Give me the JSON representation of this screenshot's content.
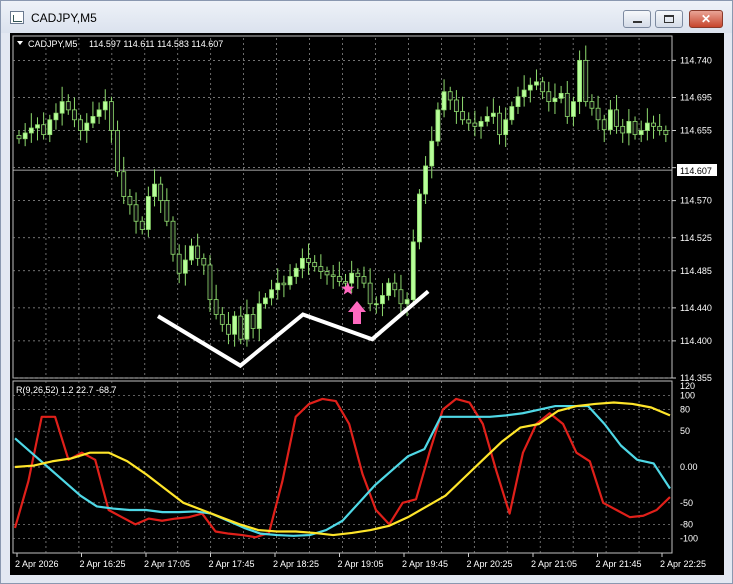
{
  "window": {
    "title": "CADJPY,M5",
    "close_glyph": "✕"
  },
  "chart_header": {
    "symbol": "CADJPY,M5",
    "ohlc": "114.597 114.611 114.583 114.607"
  },
  "indicator_label": "R(9,26,52) 1.2 22.7 -68.7",
  "current_price": "114.607",
  "colors": {
    "background": "#000000",
    "bull_candle": "#b8ff9a",
    "bear_candle": "#111111",
    "wick": "#8fdc6f",
    "grid": "#9a9a9a",
    "red_line": "#e0201a",
    "cyan_line": "#4fd8e6",
    "yellow_line": "#ffe52a",
    "star_arrow": "#ff69c0",
    "annotation_line": "#ffffff"
  },
  "chart_data": [
    {
      "type": "candlestick",
      "symbol": "CADJPY",
      "timeframe": "M5",
      "y_ticks": [
        "114.740",
        "114.695",
        "114.655",
        "114.610",
        "114.570",
        "114.525",
        "114.485",
        "114.440",
        "114.400",
        "114.355"
      ],
      "ylim": [
        114.355,
        114.755
      ],
      "x_labels": [
        "2 Apr 2026",
        "2 Apr 16:25",
        "2 Apr 17:05",
        "2 Apr 17:45",
        "2 Apr 18:25",
        "2 Apr 19:05",
        "2 Apr 19:45",
        "2 Apr 20:25",
        "2 Apr 21:05",
        "2 Apr 21:45",
        "2 Apr 22:25"
      ],
      "close_path": [
        114.645,
        114.652,
        114.658,
        114.662,
        114.65,
        114.668,
        114.676,
        114.69,
        114.68,
        114.668,
        114.655,
        114.664,
        114.672,
        114.68,
        114.69,
        114.655,
        114.605,
        114.575,
        114.565,
        114.545,
        114.535,
        114.575,
        114.59,
        114.57,
        114.545,
        114.505,
        114.482,
        114.498,
        114.515,
        114.5,
        114.492,
        114.45,
        114.432,
        114.42,
        114.408,
        114.43,
        114.402,
        114.432,
        114.415,
        114.445,
        114.452,
        114.462,
        114.47,
        114.468,
        114.478,
        114.488,
        114.5,
        114.495,
        114.49,
        114.484,
        114.48,
        114.478,
        114.472,
        114.47,
        114.482,
        114.478,
        114.47,
        114.445,
        114.445,
        114.455,
        114.47,
        114.462,
        114.445,
        114.45,
        114.52,
        114.578,
        114.612,
        114.642,
        114.68,
        114.702,
        114.692,
        114.678,
        114.668,
        114.664,
        114.66,
        114.666,
        114.672,
        114.676,
        114.65,
        114.668,
        114.684,
        114.696,
        114.704,
        114.71,
        114.714,
        114.702,
        114.69,
        114.694,
        114.7,
        114.672,
        114.69,
        114.74,
        114.69,
        114.682,
        114.668,
        114.656,
        114.68,
        114.66,
        114.652,
        114.666,
        114.65,
        114.655,
        114.664,
        114.66,
        114.655,
        114.65
      ],
      "annotations": [
        {
          "kind": "polyline",
          "points_price_units": "double-bottom W pattern (white)"
        },
        {
          "kind": "star",
          "price": 114.463
        },
        {
          "kind": "up-arrow",
          "price": 114.435
        }
      ]
    },
    {
      "type": "line",
      "title": "R(9,26,52)",
      "values_shown": [
        1.2,
        22.7,
        -68.7
      ],
      "y_ticks": [
        "120",
        "100",
        "80",
        "50",
        "0.00",
        "-50",
        "-80",
        "-100"
      ],
      "ylim": [
        -120,
        120
      ],
      "series": [
        {
          "color": "#e0201a",
          "values": [
            -85,
            -20,
            70,
            70,
            10,
            20,
            10,
            -60,
            -70,
            -80,
            -72,
            -75,
            -72,
            -70,
            -65,
            -90,
            -93,
            -95,
            -98,
            -92,
            -20,
            70,
            88,
            95,
            92,
            60,
            -10,
            -60,
            -80,
            -50,
            -45,
            20,
            80,
            95,
            90,
            60,
            -5,
            -65,
            20,
            60,
            75,
            60,
            20,
            8,
            -50,
            -60,
            -70,
            -68,
            -60,
            -42
          ]
        },
        {
          "color": "#4fd8e6",
          "values": [
            40,
            20,
            0,
            -20,
            -40,
            -55,
            -58,
            -60,
            -60,
            -63,
            -63,
            -62,
            -65,
            -75,
            -85,
            -93,
            -95,
            -96,
            -95,
            -88,
            -75,
            -50,
            -25,
            -5,
            15,
            25,
            70,
            70,
            70,
            70,
            72,
            75,
            80,
            85,
            85,
            85,
            60,
            30,
            10,
            5,
            -30
          ]
        },
        {
          "color": "#ffe52a",
          "values": [
            0,
            2,
            8,
            12,
            20,
            20,
            8,
            -10,
            -30,
            -50,
            -60,
            -70,
            -80,
            -88,
            -90,
            -90,
            -92,
            -95,
            -92,
            -88,
            -82,
            -70,
            -55,
            -40,
            -15,
            10,
            35,
            55,
            60,
            78,
            85,
            88,
            90,
            88,
            83,
            72
          ]
        }
      ]
    }
  ]
}
